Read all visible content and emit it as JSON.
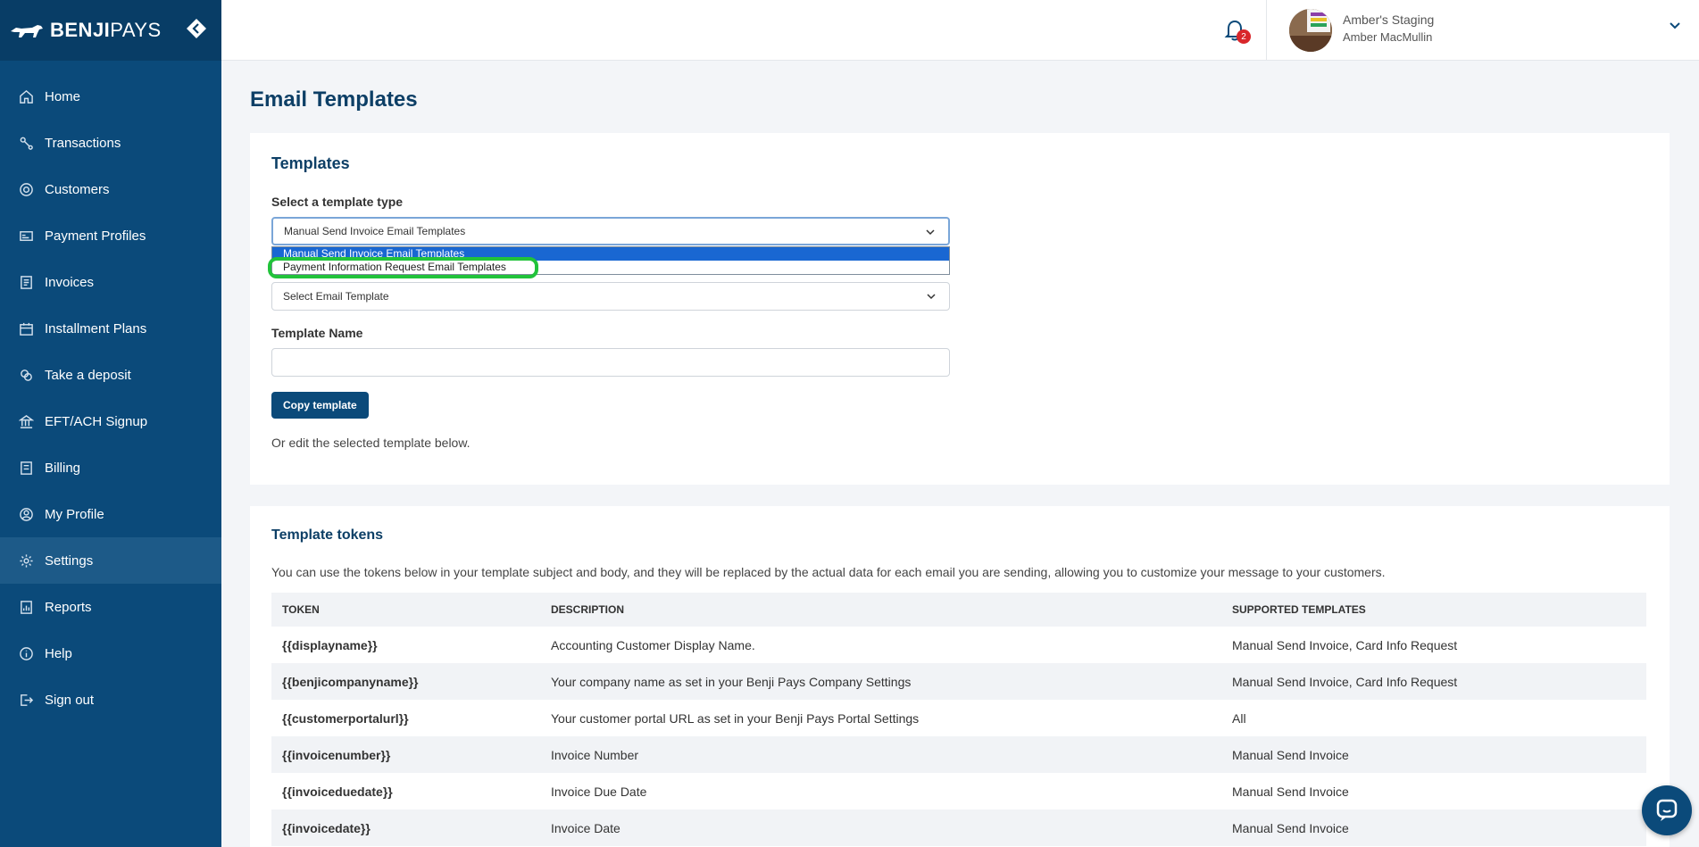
{
  "brand": {
    "name_bold": "BENJI",
    "name_light": "PAYS"
  },
  "sidebar": {
    "items": [
      {
        "label": "Home",
        "icon": "home-icon"
      },
      {
        "label": "Transactions",
        "icon": "transactions-icon"
      },
      {
        "label": "Customers",
        "icon": "customers-icon"
      },
      {
        "label": "Payment Profiles",
        "icon": "payment-profiles-icon"
      },
      {
        "label": "Invoices",
        "icon": "invoices-icon"
      },
      {
        "label": "Installment Plans",
        "icon": "calendar-icon"
      },
      {
        "label": "Take a deposit",
        "icon": "deposit-icon"
      },
      {
        "label": "EFT/ACH Signup",
        "icon": "bank-icon"
      },
      {
        "label": "Billing",
        "icon": "billing-icon"
      },
      {
        "label": "My Profile",
        "icon": "profile-icon"
      },
      {
        "label": "Settings",
        "icon": "gear-icon",
        "active": true
      },
      {
        "label": "Reports",
        "icon": "reports-icon"
      },
      {
        "label": "Help",
        "icon": "help-icon"
      },
      {
        "label": "Sign out",
        "icon": "sign-out-icon"
      }
    ]
  },
  "header": {
    "notification_count": "2",
    "org_name": "Amber's Staging",
    "user_name": "Amber MacMullin"
  },
  "page": {
    "title": "Email Templates"
  },
  "templates": {
    "title": "Templates",
    "type_label": "Select a template type",
    "type_selected": "Manual Send Invoice Email Templates",
    "type_options": [
      "Manual Send Invoice Email Templates",
      "Payment Information Request Email Templates"
    ],
    "email_template_selected": "Select Email Template",
    "name_label": "Template Name",
    "name_value": "",
    "copy_button": "Copy template",
    "helper": "Or edit the selected template below."
  },
  "tokens": {
    "title": "Template tokens",
    "description": "You can use the tokens below in your template subject and body, and they will be replaced by the actual data for each email you are sending, allowing you to customize your message to your customers.",
    "columns": [
      "TOKEN",
      "DESCRIPTION",
      "SUPPORTED TEMPLATES"
    ],
    "rows": [
      [
        "{{displayname}}",
        "Accounting Customer Display Name.",
        "Manual Send Invoice, Card Info Request"
      ],
      [
        "{{benjicompanyname}}",
        "Your company name as set in your Benji Pays Company Settings",
        "Manual Send Invoice, Card Info Request"
      ],
      [
        "{{customerportalurl}}",
        "Your customer portal URL as set in your Benji Pays Portal Settings",
        "All"
      ],
      [
        "{{invoicenumber}}",
        "Invoice Number",
        "Manual Send Invoice"
      ],
      [
        "{{invoiceduedate}}",
        "Invoice Due Date",
        "Manual Send Invoice"
      ],
      [
        "{{invoicedate}}",
        "Invoice Date",
        "Manual Send Invoice"
      ]
    ]
  },
  "colors": {
    "sidebar": "#0b4a7a",
    "accent": "#0d3f66",
    "highlight": "#21c33a",
    "badge": "#d9262a"
  }
}
